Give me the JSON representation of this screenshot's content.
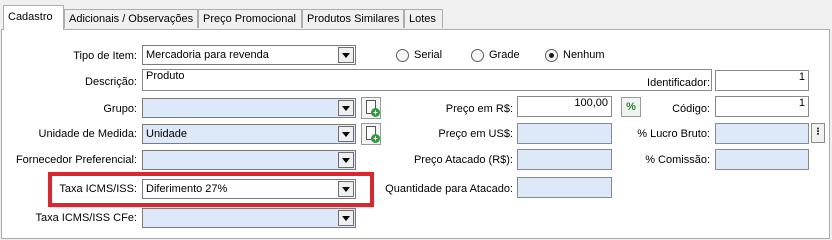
{
  "tabs": [
    {
      "label": "Cadastro",
      "active": true
    },
    {
      "label": "Adicionais / Observações",
      "active": false
    },
    {
      "label": "Preço Promocional",
      "active": false
    },
    {
      "label": "Produtos Similares",
      "active": false
    },
    {
      "label": "Lotes",
      "active": false
    }
  ],
  "form": {
    "tipo_item": {
      "label": "Tipo de Item:",
      "value": "Mercadoria para revenda"
    },
    "radios": [
      {
        "label": "Serial",
        "checked": false
      },
      {
        "label": "Grade",
        "checked": false
      },
      {
        "label": "Nenhum",
        "checked": true
      }
    ],
    "descricao": {
      "label": "Descrição:",
      "value": "Produto"
    },
    "identificador": {
      "label": "Identificador:",
      "value": "1"
    },
    "grupo": {
      "label": "Grupo:",
      "value": ""
    },
    "preco_rs": {
      "label": "Preço em R$:",
      "value": "100,00"
    },
    "codigo": {
      "label": "Código:",
      "value": "1"
    },
    "unidade": {
      "label": "Unidade de Medida:",
      "value": "Unidade"
    },
    "preco_us": {
      "label": "Preço em US$:",
      "value": ""
    },
    "lucro_bruto": {
      "label": "% Lucro Bruto:",
      "value": ""
    },
    "fornecedor": {
      "label": "Fornecedor Preferencial:",
      "value": ""
    },
    "preco_atacado": {
      "label": "Preço Atacado (R$):",
      "value": ""
    },
    "comissao": {
      "label": "% Comissão:",
      "value": ""
    },
    "taxa_icms": {
      "label": "Taxa ICMS/ISS:",
      "value": "Diferimento 27%"
    },
    "quantidade_atacado": {
      "label": "Quantidade para Atacado:",
      "value": ""
    },
    "taxa_icms_cfe": {
      "label": "Taxa ICMS/ISS CFe:",
      "value": ""
    }
  },
  "icons": {
    "new_group": "new-document-icon",
    "new_unit": "new-document-icon",
    "percent": "percent-icon",
    "more": "ellipsis-icon"
  },
  "colors": {
    "field_bg": "#dde8f8",
    "highlight": "#e0242c"
  }
}
